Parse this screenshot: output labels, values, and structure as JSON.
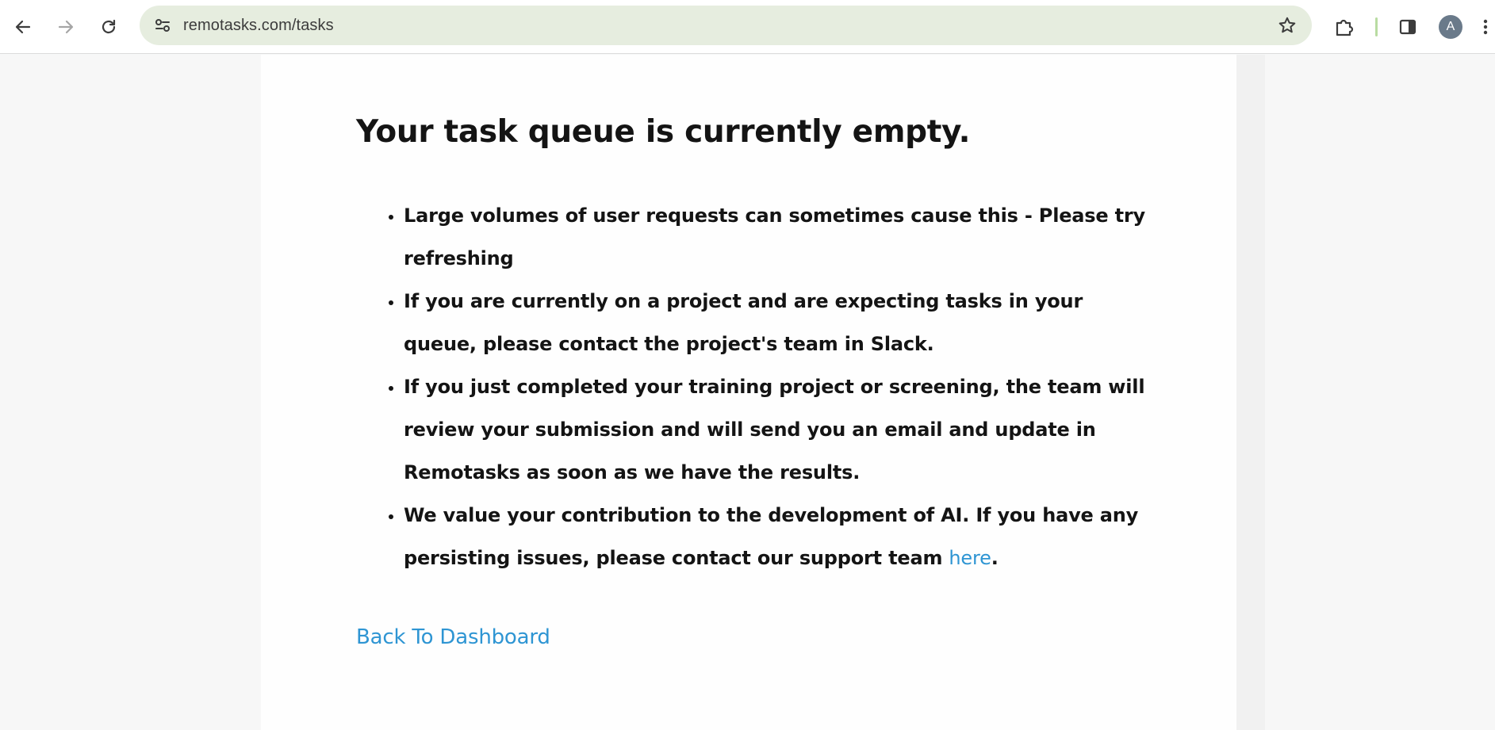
{
  "browser": {
    "url": "remotasks.com/tasks",
    "profile_initial": "A",
    "icons": {
      "back": "arrow-left-icon",
      "forward": "arrow-right-icon",
      "reload": "reload-icon",
      "site_info": "tune-icon",
      "bookmark": "star-icon",
      "extensions": "puzzle-icon",
      "side_panel": "side-panel-icon"
    },
    "colors": {
      "omnibox_bg": "#e6eddf",
      "divider": "#b9dca2",
      "avatar_bg": "#6a7a8a"
    }
  },
  "page": {
    "heading": "Your task queue is currently empty.",
    "notes": [
      "Large volumes of user requests can sometimes cause this - Please try refreshing",
      "If you are currently on a project and are expecting tasks in your queue, please contact the project's team in Slack.",
      "If you just completed your training project or screening, the team will review your submission and will send you an email and update in Remotasks as soon as we have the results.",
      "We value your contribution to the development of AI. If you have any persisting issues, please contact our support team "
    ],
    "support_link_label": "here",
    "support_link_suffix": ".",
    "back_link_label": "Back To Dashboard",
    "colors": {
      "link": "#2e95d3",
      "text": "#141414"
    }
  }
}
